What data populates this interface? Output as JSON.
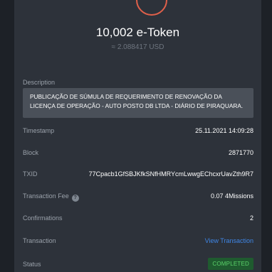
{
  "token": {
    "amount": "10,002 e-Token",
    "fiat": "≈ 2.088417 USD"
  },
  "description": {
    "label": "Description",
    "text": "PUBLICAÇÃO DE SÚMULA DE REQUERIMENTO DE RENOVAÇÃO DA LICENÇA DE OPERAÇÃO - AUTO POSTO DB LTDA - DIÁRIO DE PIRAQUARA."
  },
  "details": {
    "timestamp": {
      "label": "Timestamp",
      "value": "25.11.2021 14:09:28"
    },
    "block": {
      "label": "Block",
      "value": "2871770"
    },
    "txid": {
      "label": "TXID",
      "value": "77Cpacb1GfSBJKfkSNfHMRYcmLwwgEChcxrUavZth9R7"
    },
    "fee": {
      "label": "Transaction Fee",
      "help_icon": "?",
      "value": "0.07 4Missions"
    },
    "confirmations": {
      "label": "Confirmations",
      "value": "2"
    },
    "transaction": {
      "label": "Transaction",
      "link": "View Transaction"
    },
    "status": {
      "label": "Status",
      "value": "COMPLETED"
    }
  },
  "colors": {
    "background": "#1d2127",
    "panel": "#2d323a",
    "link": "#3f86e6",
    "success": "#5bd36a",
    "accent_arc": "#e0604a"
  }
}
